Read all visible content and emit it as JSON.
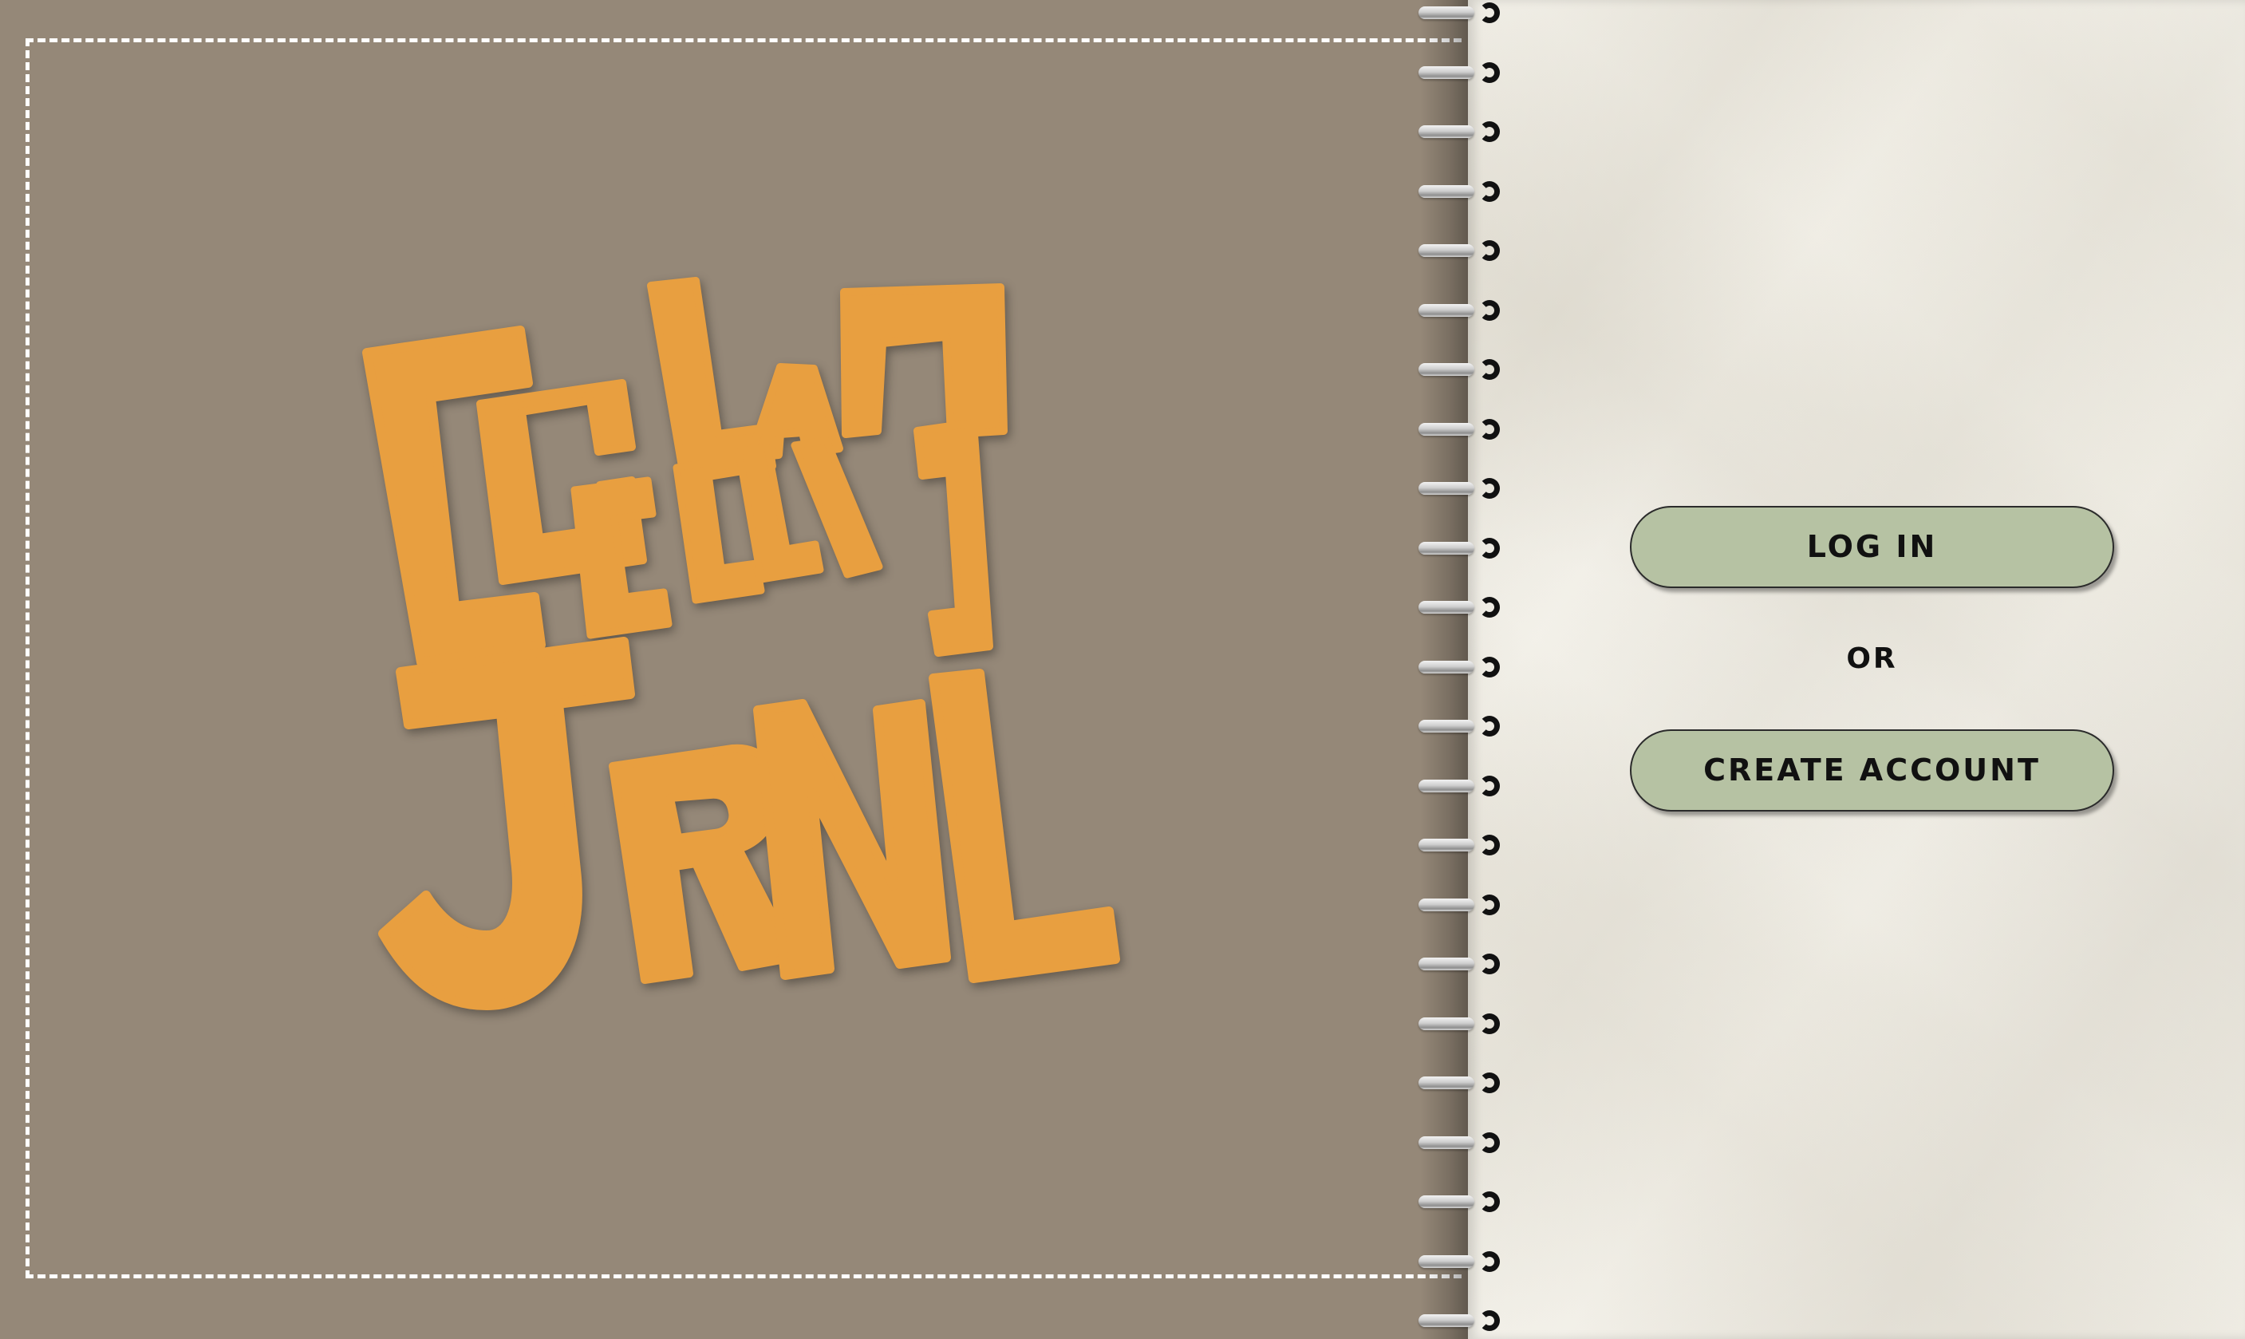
{
  "cover": {
    "background_color": "#958878",
    "logo": {
      "text_lines": [
        "COLAB",
        "COLLAB",
        "JRNL"
      ],
      "color": "#e89f40"
    }
  },
  "auth": {
    "login_label": "LOG IN",
    "or_label": "OR",
    "create_account_label": "CREATE ACCOUNT",
    "button_color": "#b6c2a3"
  }
}
